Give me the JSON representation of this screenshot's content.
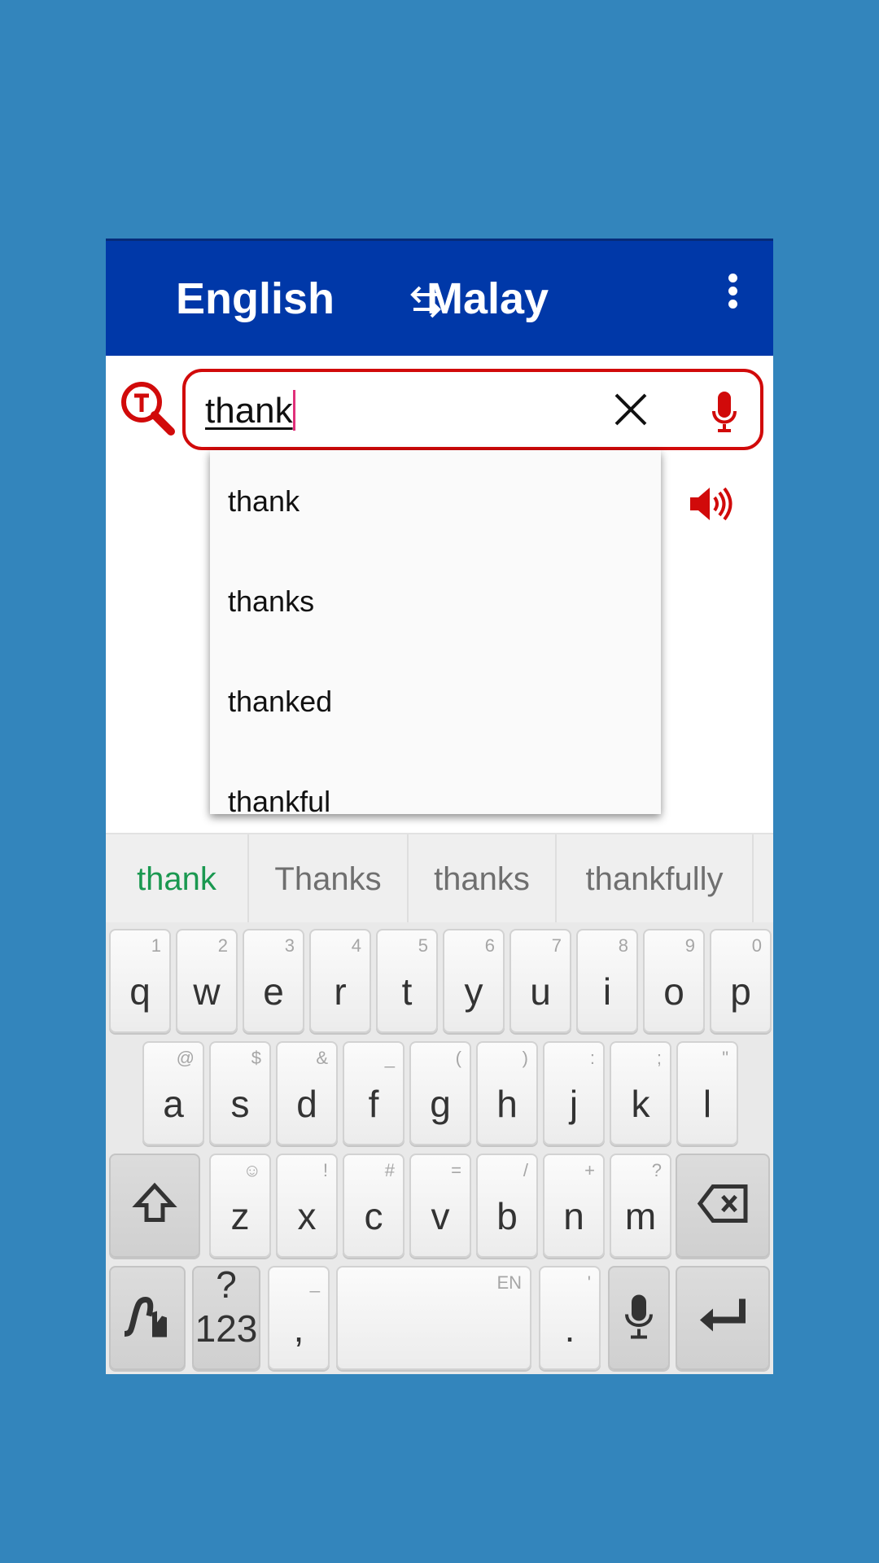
{
  "header": {
    "source_lang": "English",
    "target_lang": "Malay",
    "swap_icon": "swap-arrows-icon",
    "menu_icon": "more-vertical-icon"
  },
  "search": {
    "value": "thank",
    "logo_icon": "translate-search-logo-icon",
    "clear_icon": "close-icon",
    "mic_icon": "microphone-icon"
  },
  "speaker_icon": "speaker-icon",
  "dropdown": [
    "thank",
    "thanks",
    "thanked",
    "thankful"
  ],
  "suggestions": [
    {
      "text": "thank",
      "color": "#1a9850"
    },
    {
      "text": "Thanks"
    },
    {
      "text": "thanks"
    },
    {
      "text": "thankfully"
    }
  ],
  "colors": {
    "header": "#0038a8",
    "accent_red": "#d10a0a",
    "background": "#3385bc"
  },
  "keyboard": {
    "row1": [
      {
        "k": "q",
        "h": "1"
      },
      {
        "k": "w",
        "h": "2"
      },
      {
        "k": "e",
        "h": "3"
      },
      {
        "k": "r",
        "h": "4"
      },
      {
        "k": "t",
        "h": "5"
      },
      {
        "k": "y",
        "h": "6"
      },
      {
        "k": "u",
        "h": "7"
      },
      {
        "k": "i",
        "h": "8"
      },
      {
        "k": "o",
        "h": "9"
      },
      {
        "k": "p",
        "h": "0"
      }
    ],
    "row2": [
      {
        "k": "a",
        "h": "@"
      },
      {
        "k": "s",
        "h": "$"
      },
      {
        "k": "d",
        "h": "&"
      },
      {
        "k": "f",
        "h": "_"
      },
      {
        "k": "g",
        "h": "("
      },
      {
        "k": "h",
        "h": ")"
      },
      {
        "k": "j",
        "h": ":"
      },
      {
        "k": "k",
        "h": ";"
      },
      {
        "k": "l",
        "h": "\""
      }
    ],
    "row3": [
      {
        "k": "z",
        "h": "☺"
      },
      {
        "k": "x",
        "h": "!"
      },
      {
        "k": "c",
        "h": "#"
      },
      {
        "k": "v",
        "h": "="
      },
      {
        "k": "b",
        "h": "/"
      },
      {
        "k": "n",
        "h": "+"
      },
      {
        "k": "m",
        "h": "?"
      }
    ],
    "symbols_label": "?123",
    "comma": ",",
    "comma_hint": "_",
    "space_hint": "EN",
    "period": ".",
    "period_hint": "'",
    "shift_icon": "shift-icon",
    "backspace_icon": "backspace-icon",
    "swipe_icon": "swipe-gesture-icon",
    "mic_icon": "microphone-icon",
    "enter_icon": "enter-icon"
  }
}
